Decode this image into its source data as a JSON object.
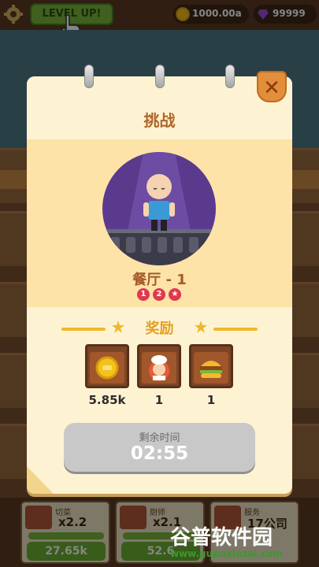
{
  "topbar": {
    "level_up_label": "LEVEL UP!",
    "coins": "1000.00a",
    "gems": "99999"
  },
  "bottom_cards": [
    {
      "label": "切菜",
      "multiplier": "x2.2",
      "price": "27.65k"
    },
    {
      "label": "厨师",
      "multiplier": "x2.1",
      "price": "52.6"
    },
    {
      "label": "服务",
      "multiplier": "17公司"
    }
  ],
  "popup": {
    "title": "挑战",
    "restaurant_name": "餐厅 - 1",
    "stars": [
      "1",
      "2",
      "★"
    ],
    "reward_title": "奖励",
    "rewards": [
      {
        "icon": "coin-icon",
        "value": "5.85k"
      },
      {
        "icon": "chef-icon",
        "value": "1"
      },
      {
        "icon": "burger-icon",
        "value": "1"
      }
    ],
    "timer_label": "剩余时间",
    "timer_value": "02:55",
    "close_symbol": "✕"
  },
  "watermark": {
    "title": "谷普软件园",
    "url": "www.gupuxiazai.com"
  },
  "colors": {
    "accent": "#b06628",
    "reward": "#e2a020",
    "portrait_bg": "#5b3a8e",
    "button_green": "#6cb032"
  }
}
